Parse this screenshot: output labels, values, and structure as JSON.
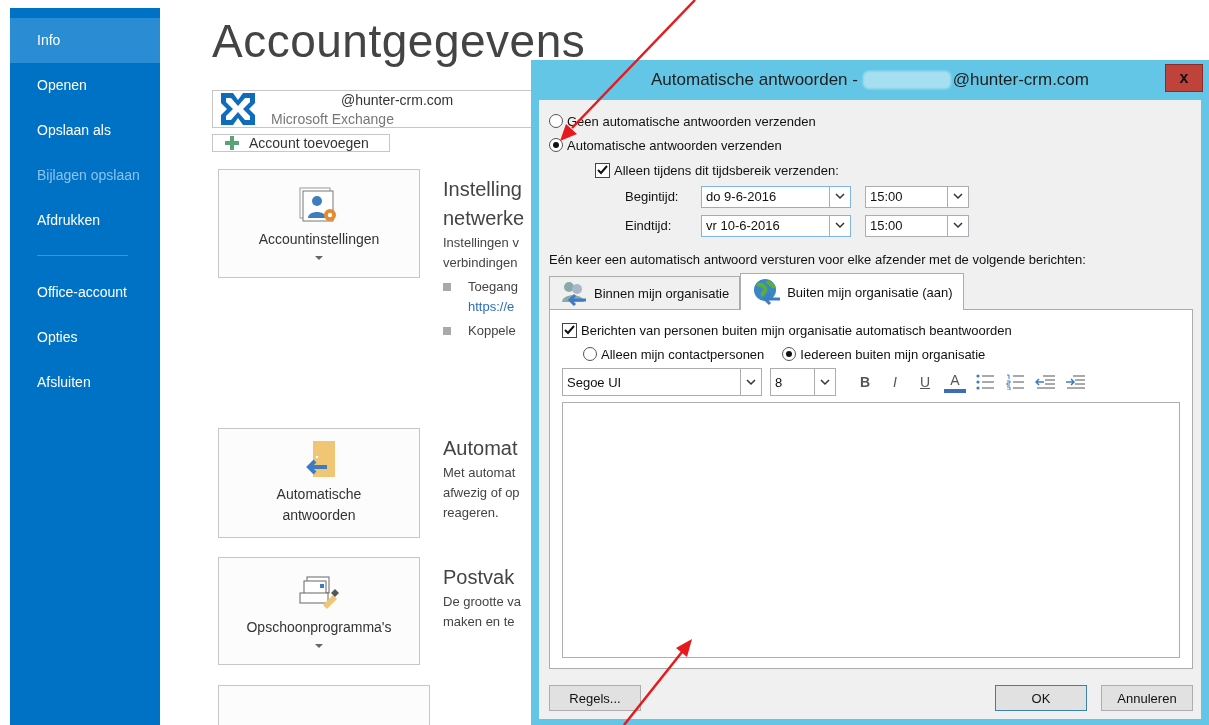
{
  "sidebar": {
    "sections": [
      {
        "items": [
          {
            "label": "Info",
            "selected": true,
            "disabled": false
          },
          {
            "label": "Openen",
            "selected": false,
            "disabled": false
          },
          {
            "label": "Opslaan als",
            "selected": false,
            "disabled": false
          },
          {
            "label": "Bijlagen opslaan",
            "selected": false,
            "disabled": true
          },
          {
            "label": "Afdrukken",
            "selected": false,
            "disabled": false
          }
        ]
      },
      {
        "items": [
          {
            "label": "Office-account",
            "selected": false,
            "disabled": false
          },
          {
            "label": "Opties",
            "selected": false,
            "disabled": false
          },
          {
            "label": "Afsluiten",
            "selected": false,
            "disabled": false
          }
        ]
      }
    ]
  },
  "page": {
    "title": "Accountgegevens",
    "account": {
      "email": "@hunter-crm.com",
      "type": "Microsoft Exchange"
    },
    "add_account_button": "Account toevoegen",
    "sections": [
      {
        "kind": "account-settings",
        "button": "Accountinstellingen",
        "dropdown": true,
        "heading_lines": [
          "Instelling",
          "netwerke"
        ],
        "description_lines": [
          "Instellingen v",
          "verbindingen"
        ],
        "bullets": [
          {
            "text": "Toegang",
            "link": "https://e"
          },
          {
            "text": "Koppele"
          }
        ]
      },
      {
        "kind": "auto-reply",
        "button": "Automatische antwoorden",
        "dropdown": false,
        "heading_lines": [
          "Automat"
        ],
        "description_lines": [
          "Met automat",
          "afwezig of op",
          "reageren."
        ]
      },
      {
        "kind": "cleanup",
        "button": "Opschoonprogramma's",
        "dropdown": true,
        "heading_lines": [
          "Postvak"
        ],
        "description_lines": [
          "De grootte va",
          "maken en te"
        ]
      },
      {
        "kind": "partial"
      }
    ]
  },
  "dialog": {
    "title_prefix": "Automatische antwoorden - ",
    "title_suffix": "@hunter-crm.com",
    "close": "x",
    "reply_modes": [
      {
        "label": "Geen automatische antwoorden verzenden",
        "selected": false
      },
      {
        "label": "Automatische antwoorden verzenden",
        "selected": true
      }
    ],
    "time_range": {
      "label": "Alleen tijdens dit tijdsbereik verzenden:",
      "checked": true,
      "rows": [
        {
          "label": "Begintijd:",
          "date": "do 9-6-2016",
          "time": "15:00"
        },
        {
          "label": "Eindtijd:",
          "date": "vr 10-6-2016",
          "time": "15:00"
        }
      ]
    },
    "instruction": "Eén keer een automatisch antwoord versturen voor elke afzender met de volgende berichten:",
    "tabs": [
      {
        "label": "Binnen mijn organisatie",
        "kind": "inside",
        "selected": false
      },
      {
        "label": "Buiten mijn organisatie (aan)",
        "kind": "outside",
        "selected": true
      }
    ],
    "outside": {
      "auto_reply": {
        "label": "Berichten van personen buiten mijn organisatie automatisch beantwoorden",
        "checked": true
      },
      "audience": [
        {
          "label": "Alleen mijn contactpersonen",
          "selected": false
        },
        {
          "label": "Iedereen buiten mijn organisatie",
          "selected": true
        }
      ]
    },
    "toolbar": {
      "font": "Segoe UI",
      "size": "8",
      "buttons": [
        {
          "kind": "bold",
          "label": "B"
        },
        {
          "kind": "italic",
          "label": "I"
        },
        {
          "kind": "underline",
          "label": "U"
        },
        {
          "kind": "font-color",
          "label": "A"
        },
        {
          "kind": "bullets"
        },
        {
          "kind": "numbering"
        },
        {
          "kind": "outdent"
        },
        {
          "kind": "indent"
        }
      ]
    },
    "footer": {
      "rules_button": "Regels...",
      "buttons": [
        {
          "label": "OK",
          "default": true
        },
        {
          "label": "Annuleren",
          "default": false
        }
      ]
    }
  }
}
